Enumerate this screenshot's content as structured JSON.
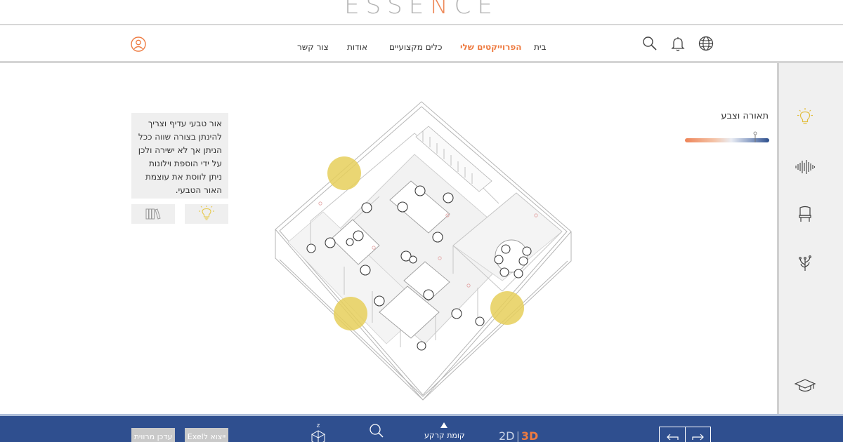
{
  "logo": {
    "text_a": "ESSE",
    "text_b": "N",
    "text_c": "CE"
  },
  "nav": {
    "items": [
      {
        "label": "בית",
        "active": false
      },
      {
        "label": "הפרוייקטים שלי",
        "active": true
      },
      {
        "label": "כלים מקצועיים",
        "active": false
      },
      {
        "label": "אודות",
        "active": false
      },
      {
        "label": "צור קשר",
        "active": false
      }
    ],
    "icons": [
      "globe-icon",
      "bell-icon",
      "search-icon",
      "user-icon"
    ]
  },
  "lighting": {
    "title": "תאורה וצבע",
    "slider_value": 0.82
  },
  "info": {
    "text": "אור טבעי עדיף וצריך להינתן בצורה שווה ככל הניתן אך לא ישירה ולכן על ידי הוספת וילונות ניתן לווסת את עוצמת האור הטבעי."
  },
  "sidebar": {
    "icons": [
      "lightbulb-icon",
      "sound-wave-icon",
      "chair-icon",
      "plant-icon",
      "graduation-cap-icon"
    ]
  },
  "bottom": {
    "update_project": "עדכן מרווית",
    "export_excel": "ייצוא לExel",
    "floor_label": "קומת קרקע",
    "view_2d": "2D",
    "view_sep": "|",
    "view_3d": "3D",
    "axis_z": "Z"
  },
  "colors": {
    "accent": "#ee7b41",
    "bottom_bar": "#2f4f8f",
    "light_spot": "#e6cf5a"
  }
}
